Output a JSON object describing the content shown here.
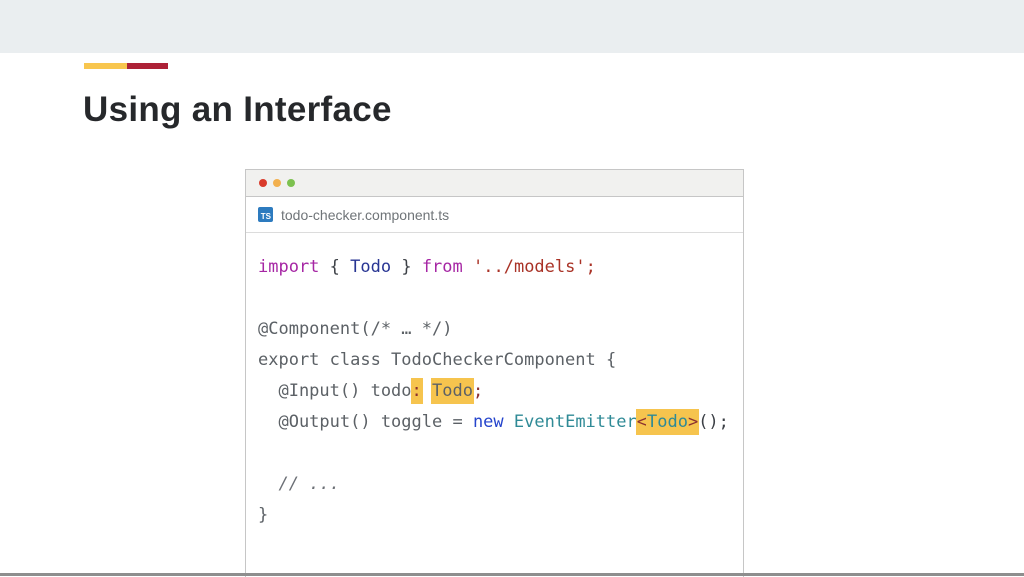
{
  "slide": {
    "title": "Using an Interface"
  },
  "window": {
    "traffic_lights": [
      {
        "name": "close",
        "color_key": "dot_red"
      },
      {
        "name": "minimize",
        "color_key": "dot_yellow"
      },
      {
        "name": "zoom",
        "color_key": "dot_green"
      }
    ],
    "tab": {
      "badge_label": "TS",
      "filename": "todo-checker.component.ts"
    },
    "code": {
      "lines": [
        {
          "tokens": [
            {
              "t": "import",
              "c": "keyword"
            },
            {
              "t": " { ",
              "c": "plain"
            },
            {
              "t": "Todo",
              "c": "type"
            },
            {
              "t": " } ",
              "c": "plain"
            },
            {
              "t": "from",
              "c": "keyword"
            },
            {
              "t": " ",
              "c": "plain"
            },
            {
              "t": "'../models'",
              "c": "string"
            },
            {
              "t": ";",
              "c": "string"
            }
          ]
        },
        {
          "tokens": []
        },
        {
          "tokens": [
            {
              "t": "@Component(/* … */)",
              "c": "gray"
            }
          ]
        },
        {
          "tokens": [
            {
              "t": "export class TodoCheckerComponent {",
              "c": "gray"
            }
          ]
        },
        {
          "tokens": [
            {
              "t": "  @Input() todo",
              "c": "gray"
            },
            {
              "t": ":",
              "c": "maroon",
              "hl": true
            },
            {
              "t": " ",
              "c": "plain"
            },
            {
              "t": "Todo",
              "c": "gray",
              "hl": true
            },
            {
              "t": ";",
              "c": "maroon"
            }
          ]
        },
        {
          "tokens": [
            {
              "t": "  @Output() toggle = ",
              "c": "gray"
            },
            {
              "t": "new",
              "c": "blue"
            },
            {
              "t": " ",
              "c": "plain"
            },
            {
              "t": "EventEmitter",
              "c": "teal"
            },
            {
              "t": "<",
              "c": "maroon",
              "hl": true
            },
            {
              "t": "Todo",
              "c": "teal",
              "hl": true
            },
            {
              "t": ">",
              "c": "maroon",
              "hl": true
            },
            {
              "t": "();",
              "c": "plain"
            }
          ]
        },
        {
          "tokens": []
        },
        {
          "tokens": [
            {
              "t": "  // ...",
              "c": "comment"
            }
          ]
        },
        {
          "tokens": [
            {
              "t": "}",
              "c": "gray"
            }
          ]
        }
      ]
    }
  },
  "palette": {
    "topbar_bg": "#eaeef0",
    "accent_yellow": "#f8c64e",
    "accent_red": "#ad2137",
    "title": "#26282b",
    "window_border": "#c6c6c6",
    "titlebar_bg": "#f1f1ef",
    "dot_red": "#d93b2b",
    "dot_yellow": "#f2b04e",
    "dot_green": "#7dc14f",
    "ts_blue": "#2d7bbf",
    "filename": "#6f7478",
    "code_keyword": "#a626a4",
    "code_type": "#283593",
    "code_string": "#a93226",
    "code_gray": "#5c6166",
    "code_plain": "#3c4046",
    "code_blue": "#2645cc",
    "code_teal": "#2f8a96",
    "code_maroon": "#8b3030",
    "code_comment": "#6c7076",
    "highlight": "#f6c44e",
    "bottom_edge": "#8e8e8e"
  }
}
